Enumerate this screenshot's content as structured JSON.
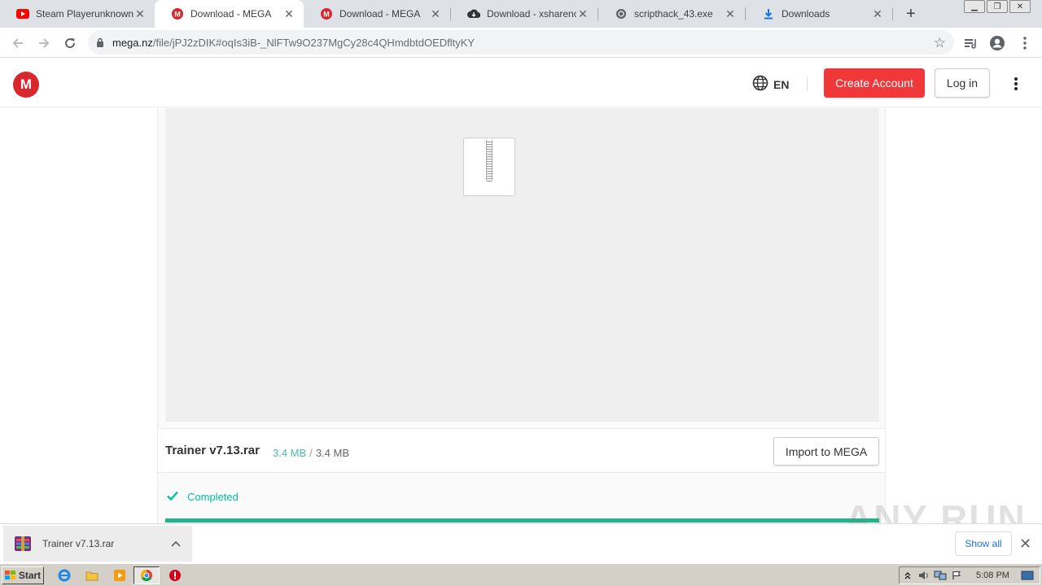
{
  "browser": {
    "tabs": [
      {
        "title": "Steam Playerunknown's B",
        "icon": "youtube-icon",
        "active": false
      },
      {
        "title": "Download - MEGA",
        "icon": "mega-icon",
        "active": true
      },
      {
        "title": "Download - MEGA",
        "icon": "mega-icon",
        "active": false
      },
      {
        "title": "Download - xsharenode.",
        "icon": "cloud-icon",
        "active": false
      },
      {
        "title": "scripthack_43.exe",
        "icon": "globe-icon",
        "active": false
      },
      {
        "title": "Downloads",
        "icon": "download-icon",
        "active": false
      }
    ],
    "new_tab": "+",
    "url_host": "mega.nz",
    "url_rest": "/file/jPJ2zDIK#oqIs3iB-_NlFTw9O237MgCy28c4QHmdbtdOEDfltyKY"
  },
  "mega": {
    "logo": "M",
    "language": "EN",
    "create_account": "Create Account",
    "login": "Log in"
  },
  "file": {
    "name": "Trainer v7.13.rar",
    "downloaded": "3.4 MB",
    "separator": "/",
    "total": "3.4 MB",
    "import_label": "Import to MEGA",
    "status": "Completed",
    "progress_fraction": 1.0
  },
  "shelf": {
    "item_name": "Trainer v7.13.rar",
    "show_all": "Show all"
  },
  "watermark": "ANY RUN",
  "taskbar": {
    "start": "Start",
    "clock": "5:08 PM"
  },
  "colors": {
    "mega_red": "#d9272e",
    "create_btn": "#f0373a",
    "progress": "#1fb68c",
    "status_green": "#00bfa5"
  }
}
